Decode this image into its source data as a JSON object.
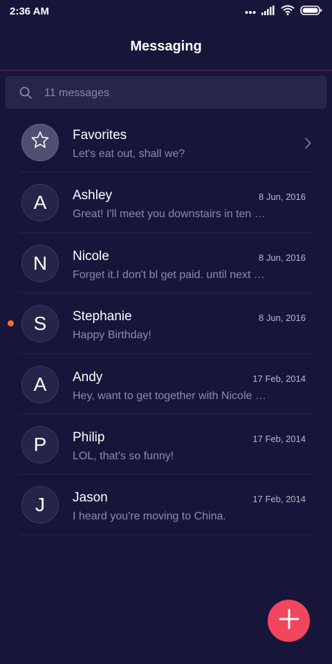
{
  "status_bar": {
    "time": "2:36 AM"
  },
  "header": {
    "title": "Messaging"
  },
  "search": {
    "placeholder": "11 messages"
  },
  "favorites": {
    "name": "Favorites",
    "preview": "Let's eat out, shall we?"
  },
  "conversations": [
    {
      "initial": "A",
      "name": "Ashley",
      "date": "8 Jun, 2016",
      "preview": "Great! I'll meet you downstairs in ten minutes.",
      "unread": false
    },
    {
      "initial": "N",
      "name": "Nicole",
      "date": "8 Jun, 2016",
      "preview": "Forget it.I don't bl get paid. until next Friday.",
      "unread": false
    },
    {
      "initial": "S",
      "name": "Stephanie",
      "date": "8 Jun, 2016",
      "preview": "Happy Birthday!",
      "unread": true
    },
    {
      "initial": "A",
      "name": "Andy",
      "date": "17 Feb, 2014",
      "preview": "Hey, want to get together with Nicole tonight?",
      "unread": false
    },
    {
      "initial": "P",
      "name": "Philip",
      "date": "17 Feb, 2014",
      "preview": "LOL, that's so funny!",
      "unread": false
    },
    {
      "initial": "J",
      "name": "Jason",
      "date": "17 Feb, 2014",
      "preview": "I heard you're moving to China.",
      "unread": false
    }
  ],
  "colors": {
    "background": "#17163a",
    "fab": "#f2455e",
    "unread_dot": "#ff6b2c",
    "divider": "#5b2b63"
  },
  "icons": [
    "signal-icon",
    "wifi-icon",
    "battery-icon",
    "search-icon",
    "star-icon",
    "chevron-right-icon",
    "plus-icon"
  ]
}
